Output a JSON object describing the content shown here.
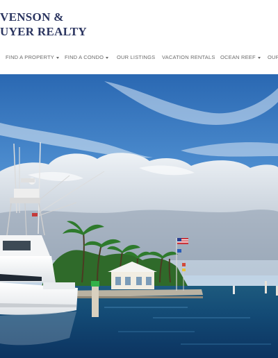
{
  "logo": {
    "line1": "VENSON &",
    "line2": "UYER REALTY"
  },
  "nav": {
    "items": [
      {
        "label": "FIND A PROPERTY",
        "dropdown": true
      },
      {
        "label": "FIND A CONDO",
        "dropdown": true
      },
      {
        "label": "OUR LISTINGS",
        "dropdown": false
      },
      {
        "label": "VACATION RENTALS",
        "dropdown": false
      },
      {
        "label": "OCEAN REEF",
        "dropdown": true
      },
      {
        "label": "OUR",
        "dropdown": false
      }
    ]
  },
  "colors": {
    "brand": "#2b3560",
    "nav_text": "#6b6b6b",
    "sky": "#2f6cb4",
    "water": "#123c66"
  },
  "hero": {
    "icon": "marina-photo"
  }
}
